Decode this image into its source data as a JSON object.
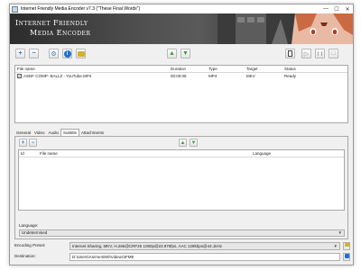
{
  "window": {
    "title": "Internet Friendly Media Encoder v7.3 (\"These Final Words\")",
    "minimize_icon": "minimize-icon",
    "maximize_icon": "maximize-icon",
    "close_icon": "close-icon"
  },
  "banner": {
    "line1": "Internet Friendly",
    "line2": "Media Encoder"
  },
  "toolbar": {
    "buttons": [
      {
        "name": "add-file-button",
        "icon": "plus-icon",
        "glyph": "+",
        "color": "#1f6fd1"
      },
      {
        "name": "remove-file-button",
        "icon": "minus-icon",
        "glyph": "−",
        "color": "#1f6fd1"
      },
      {
        "name": "settings-button",
        "icon": "wrench-icon",
        "glyph": "⚙",
        "color": "#2a8fbf"
      },
      {
        "name": "info-button",
        "icon": "info-icon",
        "glyph": "i",
        "color": "#1f6fd1"
      },
      {
        "name": "open-folder-button",
        "icon": "folder-icon",
        "glyph": "▬",
        "color": "#d4b12a"
      },
      {
        "name": "move-up-button",
        "icon": "arrow-up-icon",
        "glyph": "▲",
        "color": "#3aa33a"
      },
      {
        "name": "move-down-button",
        "icon": "arrow-down-icon",
        "glyph": "▼",
        "color": "#3aa33a"
      },
      {
        "name": "log-button",
        "icon": "document-icon",
        "glyph": "▤",
        "color": "#444444"
      },
      {
        "name": "start-button",
        "icon": "play-icon",
        "glyph": "▷",
        "color": "#999999"
      },
      {
        "name": "pause-button",
        "icon": "pause-icon",
        "glyph": "❙❙",
        "color": "#999999"
      },
      {
        "name": "stop-button",
        "icon": "stop-icon",
        "glyph": "□",
        "color": "#999999"
      }
    ]
  },
  "file_list": {
    "columns": [
      "File name",
      "Duration",
      "Type",
      "Target",
      "Status"
    ],
    "rows": [
      {
        "checked": true,
        "file_name": "ASDF COMP- BALLZ - YouTube.MP4",
        "duration": "00:00:05",
        "type": "MP4",
        "target": "MKV",
        "status": "Ready"
      }
    ]
  },
  "tabs": [
    "General",
    "Video",
    "Audio",
    "Subtitle",
    "Attachments"
  ],
  "active_tab": "Subtitle",
  "subtitle": {
    "columns": [
      "Id",
      "File name",
      "Language"
    ],
    "language_label": "Language:",
    "language_value": "Undetermined"
  },
  "encoding": {
    "preset_label": "Encoding Preset:",
    "preset_value": "Internet Sharing, MKV, H.265@CRF25 1080p@23.976fps, AAC 128kbps@44.1kHz",
    "destination_label": "Destination:",
    "destination_value": "D:\\Users\\Anime4000\\Videos\\IFME"
  },
  "colors": {
    "accent_green": "#3aa33a",
    "accent_blue": "#1f6fd1"
  }
}
